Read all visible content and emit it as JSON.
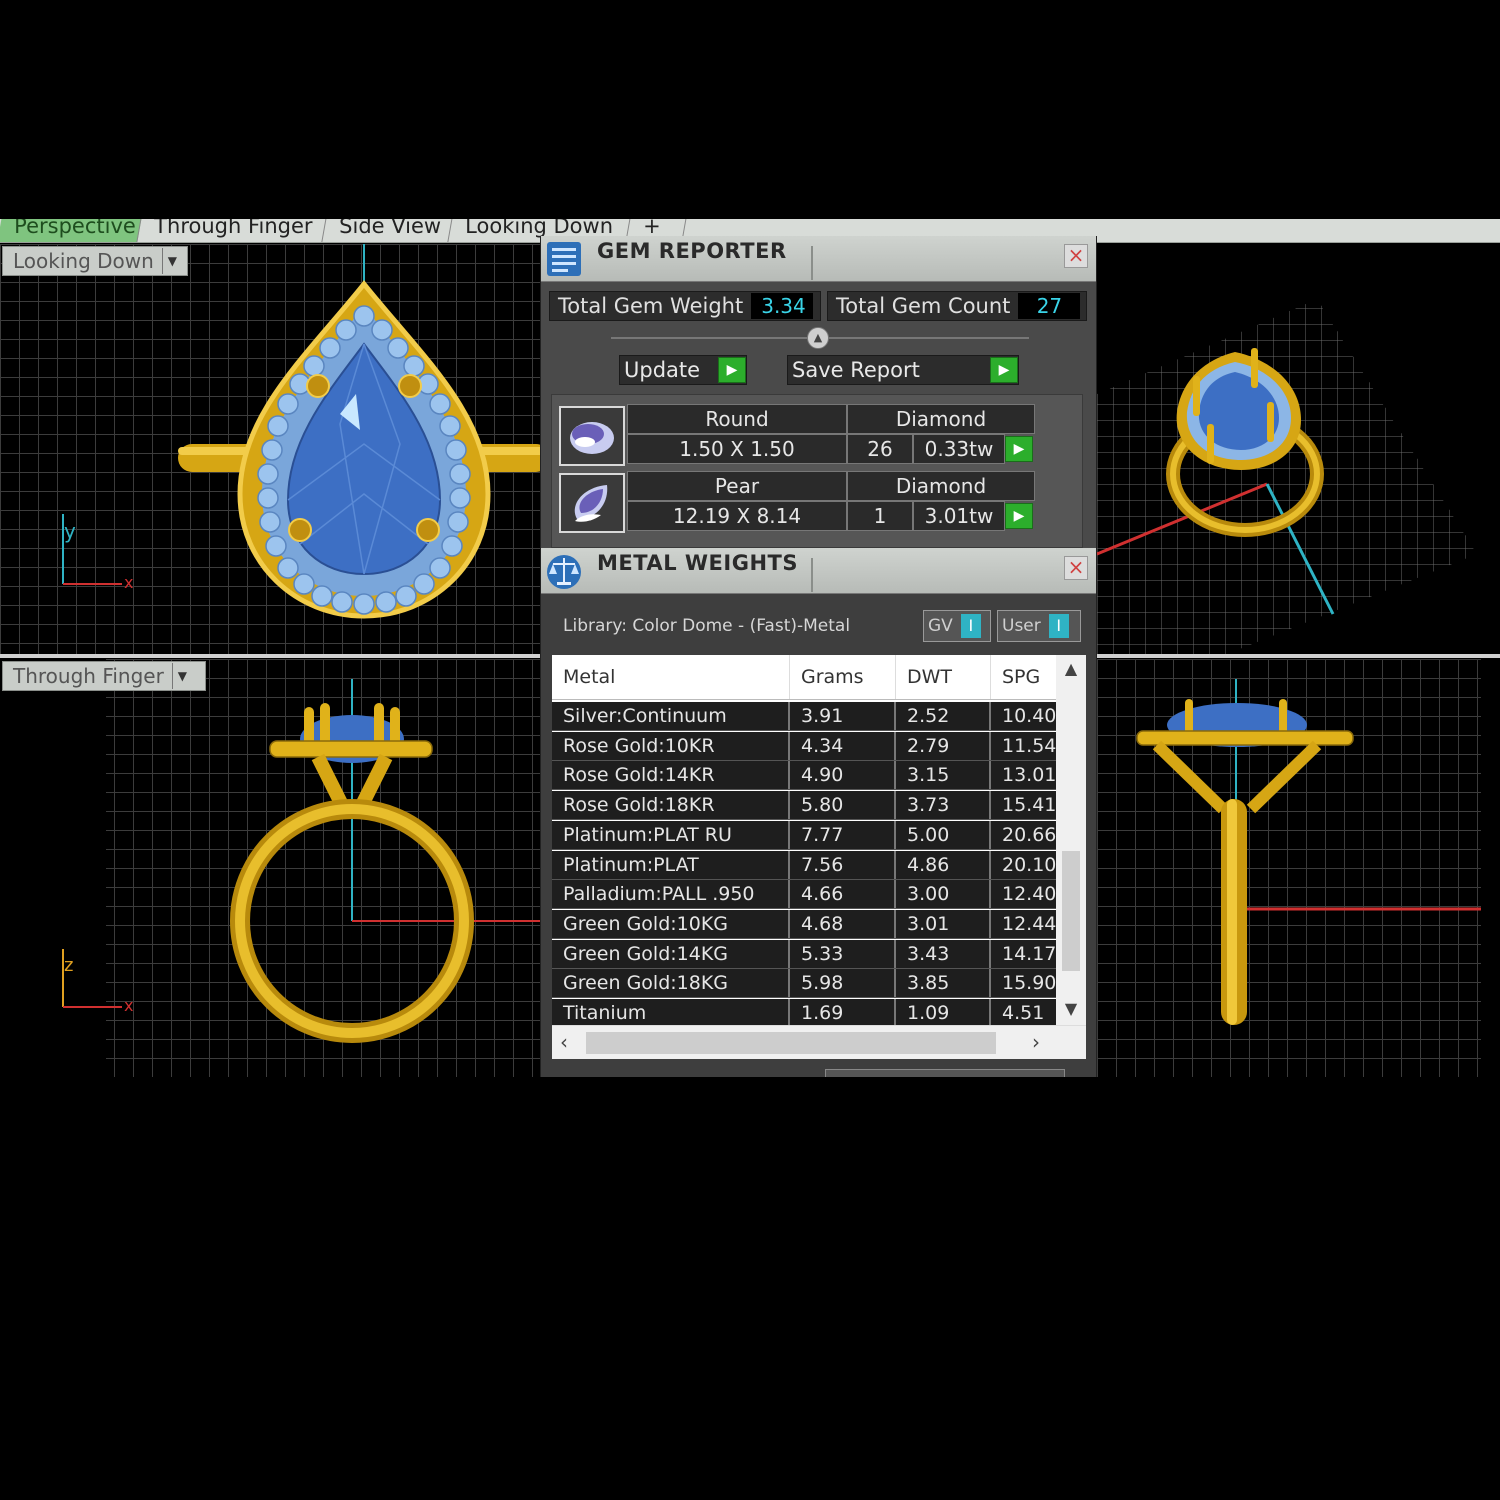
{
  "tabs": [
    {
      "label": "Perspective",
      "active": true
    },
    {
      "label": "Through Finger",
      "active": false
    },
    {
      "label": "Side View",
      "active": false
    },
    {
      "label": "Looking Down",
      "active": false
    },
    {
      "label": "+",
      "active": false
    }
  ],
  "viewports": {
    "top_left_label": "Looking Down",
    "bottom_left_label": "Through Finger",
    "dropdown_icon": "chevron-down-icon",
    "axes": {
      "x": "x",
      "y": "y",
      "z": "z"
    }
  },
  "gem_reporter": {
    "title": "GEM REPORTER",
    "total_weight_label": "Total Gem Weight",
    "total_weight_value": "3.34",
    "total_count_label": "Total Gem Count",
    "total_count_value": "27",
    "update_label": "Update",
    "save_report_label": "Save Report",
    "close_icon": "close-icon",
    "gems": [
      {
        "shape": "Round",
        "size": "1.50 X 1.50",
        "material": "Diamond",
        "count": "26",
        "weight": "0.33tw"
      },
      {
        "shape": "Pear",
        "size": "12.19 X 8.14",
        "material": "Diamond",
        "count": "1",
        "weight": "3.01tw"
      }
    ]
  },
  "metal_weights": {
    "title": "METAL WEIGHTS",
    "library": "Library: Color Dome - (Fast)-Metal",
    "toggle_gv": "GV",
    "toggle_user": "User",
    "columns": [
      "Metal",
      "Grams",
      "DWT",
      "SPG"
    ],
    "rows": [
      [
        "Silver:Continuum",
        "3.91",
        "2.52",
        "10.40"
      ],
      [
        "Rose Gold:10KR",
        "4.34",
        "2.79",
        "11.54"
      ],
      [
        "Rose Gold:14KR",
        "4.90",
        "3.15",
        "13.01"
      ],
      [
        "Rose Gold:18KR",
        "5.80",
        "3.73",
        "15.41"
      ],
      [
        "Platinum:PLAT RU",
        "7.77",
        "5.00",
        "20.66"
      ],
      [
        "Platinum:PLAT",
        "7.56",
        "4.86",
        "20.10"
      ],
      [
        "Palladium:PALL .950",
        "4.66",
        "3.00",
        "12.40"
      ],
      [
        "Green Gold:10KG",
        "4.68",
        "3.01",
        "12.44"
      ],
      [
        "Green Gold:14KG",
        "5.33",
        "3.43",
        "14.17"
      ],
      [
        "Green Gold:18KG",
        "5.98",
        "3.85",
        "15.90"
      ],
      [
        "Titanium",
        "1.69",
        "1.09",
        "4.51"
      ]
    ]
  },
  "colors": {
    "gold": "#e0b21a",
    "sapphire": "#3d6fc4",
    "halo_stone": "#9cc4ee",
    "accent_green": "#2cae2c",
    "value_cyan": "#3ad4e8"
  }
}
